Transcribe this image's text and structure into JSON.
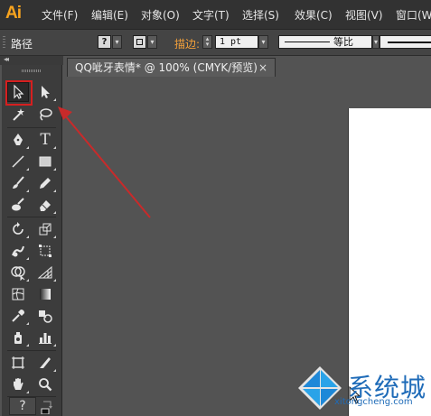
{
  "app": {
    "logo": "Ai"
  },
  "menu": [
    "文件(F)",
    "编辑(E)",
    "对象(O)",
    "文字(T)",
    "选择(S)",
    "效果(C)",
    "视图(V)",
    "窗口(W"
  ],
  "control_bar": {
    "selection_label": "路径",
    "fill_value": "?",
    "stroke_label": "描边:",
    "stroke_weight": "1 pt",
    "stroke_profile": "等比"
  },
  "document": {
    "tab_title": "QQ呲牙表情* @ 100% (CMYK/预览)",
    "close_glyph": "×"
  },
  "toolbox": {
    "collapse_glyph": "◂◂",
    "type_tool_glyph": "T",
    "help_glyph": "?"
  },
  "annotation": {
    "color": "#d61f1f"
  },
  "watermark": {
    "brand": "系统城",
    "url": "xitongcheng.com"
  },
  "colors": {
    "menubar": "#323232",
    "panel": "#3c3c3c",
    "canvas": "#535353",
    "logo": "#f7a31e"
  }
}
